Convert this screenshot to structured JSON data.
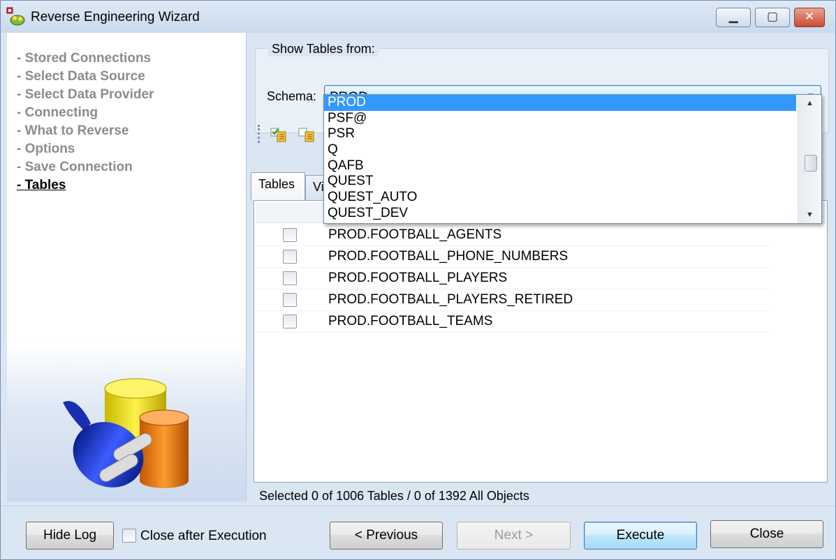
{
  "window": {
    "title": "Reverse Engineering Wizard"
  },
  "steps": [
    {
      "label": "- Stored Connections"
    },
    {
      "label": "- Select Data Source"
    },
    {
      "label": "- Select Data Provider"
    },
    {
      "label": "- Connecting"
    },
    {
      "label": "- What to Reverse"
    },
    {
      "label": "- Options"
    },
    {
      "label": "- Save Connection"
    },
    {
      "label": "- Tables"
    }
  ],
  "show_tables": {
    "legend": "Show Tables from:",
    "schema_label": "Schema:",
    "schema_value": "PROD"
  },
  "dropdown": {
    "options": [
      "PROD",
      "PSF@",
      "PSR",
      "Q",
      "QAFB",
      "QUEST",
      "QUEST_AUTO",
      "QUEST_DEV"
    ],
    "selected": "PROD"
  },
  "tabs": [
    {
      "label": "Tables"
    },
    {
      "label": "Vi"
    }
  ],
  "tables": [
    {
      "name": "PROD.FOOTBALL_AGENTS",
      "checked": false
    },
    {
      "name": "PROD.FOOTBALL_PHONE_NUMBERS",
      "checked": false
    },
    {
      "name": "PROD.FOOTBALL_PLAYERS",
      "checked": false
    },
    {
      "name": "PROD.FOOTBALL_PLAYERS_RETIRED",
      "checked": false
    },
    {
      "name": "PROD.FOOTBALL_TEAMS",
      "checked": false
    }
  ],
  "status": "Selected 0 of 1006 Tables / 0 of 1392 All Objects",
  "bottom": {
    "hide_log": "Hide Log",
    "close_after_execution": "Close after Execution",
    "previous": "< Previous",
    "next": "Next >",
    "execute": "Execute",
    "close": "Close"
  },
  "colors": {
    "selection": "#3399ff",
    "frame": "#dbe6f3",
    "active_step": "#000000",
    "inactive_step": "#8c8c8c"
  }
}
